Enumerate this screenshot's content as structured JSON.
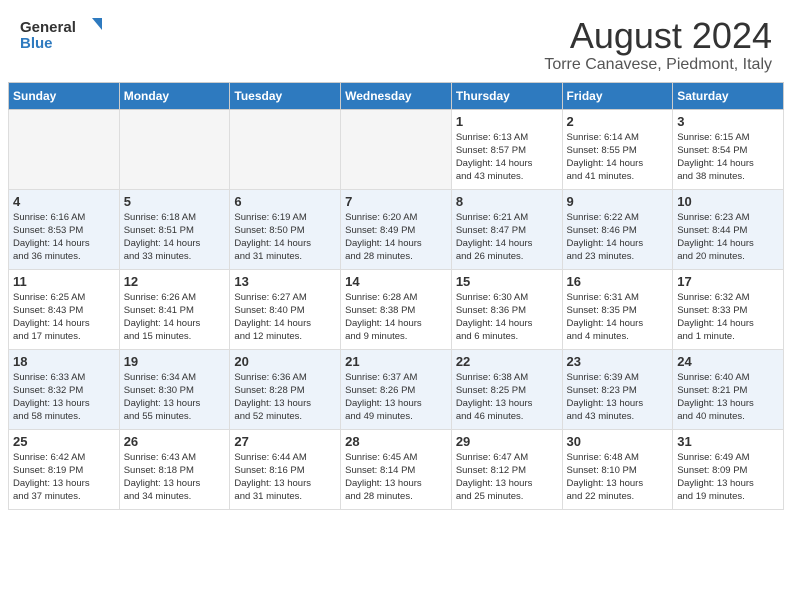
{
  "header": {
    "logo_general": "General",
    "logo_blue": "Blue",
    "month_title": "August 2024",
    "location": "Torre Canavese, Piedmont, Italy"
  },
  "weekdays": [
    "Sunday",
    "Monday",
    "Tuesday",
    "Wednesday",
    "Thursday",
    "Friday",
    "Saturday"
  ],
  "weeks": [
    [
      {
        "day": "",
        "info": ""
      },
      {
        "day": "",
        "info": ""
      },
      {
        "day": "",
        "info": ""
      },
      {
        "day": "",
        "info": ""
      },
      {
        "day": "1",
        "info": "Sunrise: 6:13 AM\nSunset: 8:57 PM\nDaylight: 14 hours\nand 43 minutes."
      },
      {
        "day": "2",
        "info": "Sunrise: 6:14 AM\nSunset: 8:55 PM\nDaylight: 14 hours\nand 41 minutes."
      },
      {
        "day": "3",
        "info": "Sunrise: 6:15 AM\nSunset: 8:54 PM\nDaylight: 14 hours\nand 38 minutes."
      }
    ],
    [
      {
        "day": "4",
        "info": "Sunrise: 6:16 AM\nSunset: 8:53 PM\nDaylight: 14 hours\nand 36 minutes."
      },
      {
        "day": "5",
        "info": "Sunrise: 6:18 AM\nSunset: 8:51 PM\nDaylight: 14 hours\nand 33 minutes."
      },
      {
        "day": "6",
        "info": "Sunrise: 6:19 AM\nSunset: 8:50 PM\nDaylight: 14 hours\nand 31 minutes."
      },
      {
        "day": "7",
        "info": "Sunrise: 6:20 AM\nSunset: 8:49 PM\nDaylight: 14 hours\nand 28 minutes."
      },
      {
        "day": "8",
        "info": "Sunrise: 6:21 AM\nSunset: 8:47 PM\nDaylight: 14 hours\nand 26 minutes."
      },
      {
        "day": "9",
        "info": "Sunrise: 6:22 AM\nSunset: 8:46 PM\nDaylight: 14 hours\nand 23 minutes."
      },
      {
        "day": "10",
        "info": "Sunrise: 6:23 AM\nSunset: 8:44 PM\nDaylight: 14 hours\nand 20 minutes."
      }
    ],
    [
      {
        "day": "11",
        "info": "Sunrise: 6:25 AM\nSunset: 8:43 PM\nDaylight: 14 hours\nand 17 minutes."
      },
      {
        "day": "12",
        "info": "Sunrise: 6:26 AM\nSunset: 8:41 PM\nDaylight: 14 hours\nand 15 minutes."
      },
      {
        "day": "13",
        "info": "Sunrise: 6:27 AM\nSunset: 8:40 PM\nDaylight: 14 hours\nand 12 minutes."
      },
      {
        "day": "14",
        "info": "Sunrise: 6:28 AM\nSunset: 8:38 PM\nDaylight: 14 hours\nand 9 minutes."
      },
      {
        "day": "15",
        "info": "Sunrise: 6:30 AM\nSunset: 8:36 PM\nDaylight: 14 hours\nand 6 minutes."
      },
      {
        "day": "16",
        "info": "Sunrise: 6:31 AM\nSunset: 8:35 PM\nDaylight: 14 hours\nand 4 minutes."
      },
      {
        "day": "17",
        "info": "Sunrise: 6:32 AM\nSunset: 8:33 PM\nDaylight: 14 hours\nand 1 minute."
      }
    ],
    [
      {
        "day": "18",
        "info": "Sunrise: 6:33 AM\nSunset: 8:32 PM\nDaylight: 13 hours\nand 58 minutes."
      },
      {
        "day": "19",
        "info": "Sunrise: 6:34 AM\nSunset: 8:30 PM\nDaylight: 13 hours\nand 55 minutes."
      },
      {
        "day": "20",
        "info": "Sunrise: 6:36 AM\nSunset: 8:28 PM\nDaylight: 13 hours\nand 52 minutes."
      },
      {
        "day": "21",
        "info": "Sunrise: 6:37 AM\nSunset: 8:26 PM\nDaylight: 13 hours\nand 49 minutes."
      },
      {
        "day": "22",
        "info": "Sunrise: 6:38 AM\nSunset: 8:25 PM\nDaylight: 13 hours\nand 46 minutes."
      },
      {
        "day": "23",
        "info": "Sunrise: 6:39 AM\nSunset: 8:23 PM\nDaylight: 13 hours\nand 43 minutes."
      },
      {
        "day": "24",
        "info": "Sunrise: 6:40 AM\nSunset: 8:21 PM\nDaylight: 13 hours\nand 40 minutes."
      }
    ],
    [
      {
        "day": "25",
        "info": "Sunrise: 6:42 AM\nSunset: 8:19 PM\nDaylight: 13 hours\nand 37 minutes."
      },
      {
        "day": "26",
        "info": "Sunrise: 6:43 AM\nSunset: 8:18 PM\nDaylight: 13 hours\nand 34 minutes."
      },
      {
        "day": "27",
        "info": "Sunrise: 6:44 AM\nSunset: 8:16 PM\nDaylight: 13 hours\nand 31 minutes."
      },
      {
        "day": "28",
        "info": "Sunrise: 6:45 AM\nSunset: 8:14 PM\nDaylight: 13 hours\nand 28 minutes."
      },
      {
        "day": "29",
        "info": "Sunrise: 6:47 AM\nSunset: 8:12 PM\nDaylight: 13 hours\nand 25 minutes."
      },
      {
        "day": "30",
        "info": "Sunrise: 6:48 AM\nSunset: 8:10 PM\nDaylight: 13 hours\nand 22 minutes."
      },
      {
        "day": "31",
        "info": "Sunrise: 6:49 AM\nSunset: 8:09 PM\nDaylight: 13 hours\nand 19 minutes."
      }
    ]
  ]
}
